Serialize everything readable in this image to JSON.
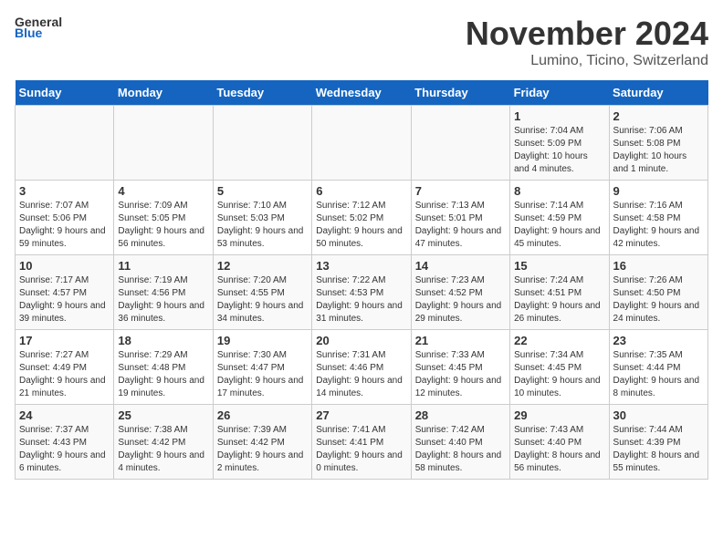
{
  "header": {
    "logo_general": "General",
    "logo_blue": "Blue",
    "month_title": "November 2024",
    "location": "Lumino, Ticino, Switzerland"
  },
  "days_of_week": [
    "Sunday",
    "Monday",
    "Tuesday",
    "Wednesday",
    "Thursday",
    "Friday",
    "Saturday"
  ],
  "weeks": [
    [
      {
        "day": "",
        "info": ""
      },
      {
        "day": "",
        "info": ""
      },
      {
        "day": "",
        "info": ""
      },
      {
        "day": "",
        "info": ""
      },
      {
        "day": "",
        "info": ""
      },
      {
        "day": "1",
        "info": "Sunrise: 7:04 AM\nSunset: 5:09 PM\nDaylight: 10 hours and 4 minutes."
      },
      {
        "day": "2",
        "info": "Sunrise: 7:06 AM\nSunset: 5:08 PM\nDaylight: 10 hours and 1 minute."
      }
    ],
    [
      {
        "day": "3",
        "info": "Sunrise: 7:07 AM\nSunset: 5:06 PM\nDaylight: 9 hours and 59 minutes."
      },
      {
        "day": "4",
        "info": "Sunrise: 7:09 AM\nSunset: 5:05 PM\nDaylight: 9 hours and 56 minutes."
      },
      {
        "day": "5",
        "info": "Sunrise: 7:10 AM\nSunset: 5:03 PM\nDaylight: 9 hours and 53 minutes."
      },
      {
        "day": "6",
        "info": "Sunrise: 7:12 AM\nSunset: 5:02 PM\nDaylight: 9 hours and 50 minutes."
      },
      {
        "day": "7",
        "info": "Sunrise: 7:13 AM\nSunset: 5:01 PM\nDaylight: 9 hours and 47 minutes."
      },
      {
        "day": "8",
        "info": "Sunrise: 7:14 AM\nSunset: 4:59 PM\nDaylight: 9 hours and 45 minutes."
      },
      {
        "day": "9",
        "info": "Sunrise: 7:16 AM\nSunset: 4:58 PM\nDaylight: 9 hours and 42 minutes."
      }
    ],
    [
      {
        "day": "10",
        "info": "Sunrise: 7:17 AM\nSunset: 4:57 PM\nDaylight: 9 hours and 39 minutes."
      },
      {
        "day": "11",
        "info": "Sunrise: 7:19 AM\nSunset: 4:56 PM\nDaylight: 9 hours and 36 minutes."
      },
      {
        "day": "12",
        "info": "Sunrise: 7:20 AM\nSunset: 4:55 PM\nDaylight: 9 hours and 34 minutes."
      },
      {
        "day": "13",
        "info": "Sunrise: 7:22 AM\nSunset: 4:53 PM\nDaylight: 9 hours and 31 minutes."
      },
      {
        "day": "14",
        "info": "Sunrise: 7:23 AM\nSunset: 4:52 PM\nDaylight: 9 hours and 29 minutes."
      },
      {
        "day": "15",
        "info": "Sunrise: 7:24 AM\nSunset: 4:51 PM\nDaylight: 9 hours and 26 minutes."
      },
      {
        "day": "16",
        "info": "Sunrise: 7:26 AM\nSunset: 4:50 PM\nDaylight: 9 hours and 24 minutes."
      }
    ],
    [
      {
        "day": "17",
        "info": "Sunrise: 7:27 AM\nSunset: 4:49 PM\nDaylight: 9 hours and 21 minutes."
      },
      {
        "day": "18",
        "info": "Sunrise: 7:29 AM\nSunset: 4:48 PM\nDaylight: 9 hours and 19 minutes."
      },
      {
        "day": "19",
        "info": "Sunrise: 7:30 AM\nSunset: 4:47 PM\nDaylight: 9 hours and 17 minutes."
      },
      {
        "day": "20",
        "info": "Sunrise: 7:31 AM\nSunset: 4:46 PM\nDaylight: 9 hours and 14 minutes."
      },
      {
        "day": "21",
        "info": "Sunrise: 7:33 AM\nSunset: 4:45 PM\nDaylight: 9 hours and 12 minutes."
      },
      {
        "day": "22",
        "info": "Sunrise: 7:34 AM\nSunset: 4:45 PM\nDaylight: 9 hours and 10 minutes."
      },
      {
        "day": "23",
        "info": "Sunrise: 7:35 AM\nSunset: 4:44 PM\nDaylight: 9 hours and 8 minutes."
      }
    ],
    [
      {
        "day": "24",
        "info": "Sunrise: 7:37 AM\nSunset: 4:43 PM\nDaylight: 9 hours and 6 minutes."
      },
      {
        "day": "25",
        "info": "Sunrise: 7:38 AM\nSunset: 4:42 PM\nDaylight: 9 hours and 4 minutes."
      },
      {
        "day": "26",
        "info": "Sunrise: 7:39 AM\nSunset: 4:42 PM\nDaylight: 9 hours and 2 minutes."
      },
      {
        "day": "27",
        "info": "Sunrise: 7:41 AM\nSunset: 4:41 PM\nDaylight: 9 hours and 0 minutes."
      },
      {
        "day": "28",
        "info": "Sunrise: 7:42 AM\nSunset: 4:40 PM\nDaylight: 8 hours and 58 minutes."
      },
      {
        "day": "29",
        "info": "Sunrise: 7:43 AM\nSunset: 4:40 PM\nDaylight: 8 hours and 56 minutes."
      },
      {
        "day": "30",
        "info": "Sunrise: 7:44 AM\nSunset: 4:39 PM\nDaylight: 8 hours and 55 minutes."
      }
    ]
  ]
}
